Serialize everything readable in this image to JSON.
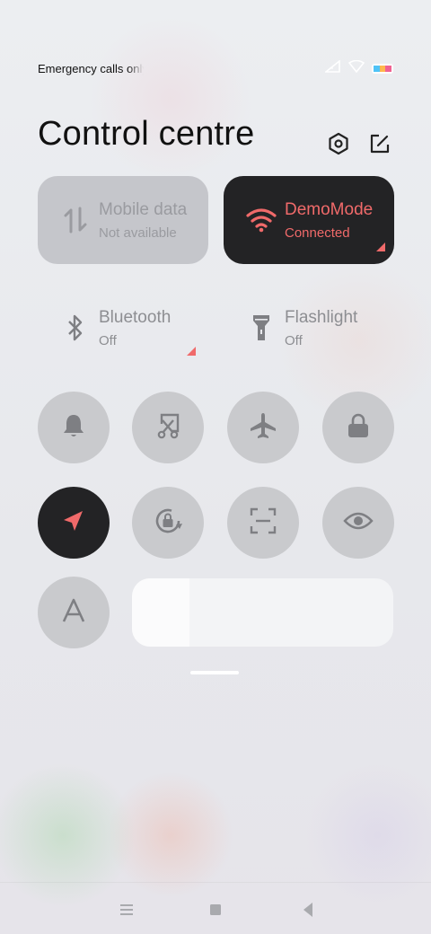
{
  "status_bar": {
    "carrier_text": "Emergency calls only",
    "icons": [
      "signal-icon",
      "wifi-icon",
      "battery-icon"
    ],
    "battery_colors": [
      "#4fc3f7",
      "#ffb74d",
      "#f06292"
    ]
  },
  "header": {
    "title": "Control centre",
    "icons": [
      "settings-icon",
      "edit-icon"
    ]
  },
  "tiles": {
    "mobile_data": {
      "label": "Mobile data",
      "status": "Not available",
      "active": false,
      "icon": "mobile-data-icon"
    },
    "wifi": {
      "label": "DemoMode",
      "status": "Connected",
      "active": true,
      "icon": "wifi-icon"
    },
    "bluetooth": {
      "label": "Bluetooth",
      "status": "Off",
      "icon": "bluetooth-icon"
    },
    "flashlight": {
      "label": "Flashlight",
      "status": "Off",
      "icon": "flashlight-icon"
    }
  },
  "toggles": [
    {
      "name": "silent",
      "icon": "bell-icon",
      "active": false
    },
    {
      "name": "screenshot",
      "icon": "screenshot-icon",
      "active": false
    },
    {
      "name": "airplane-mode",
      "icon": "airplane-icon",
      "active": false
    },
    {
      "name": "lock-screen",
      "icon": "lock-icon",
      "active": false
    },
    {
      "name": "location",
      "icon": "location-icon",
      "active": true
    },
    {
      "name": "rotation-lock",
      "icon": "rotation-lock-icon",
      "active": false
    },
    {
      "name": "scanner",
      "icon": "scan-icon",
      "active": false
    },
    {
      "name": "reading-mode",
      "icon": "eye-icon",
      "active": false
    },
    {
      "name": "auto-brightness",
      "icon": "auto-brightness-icon",
      "active": false
    }
  ],
  "brightness": {
    "level": 0.22
  },
  "colors": {
    "accent": "#f06a6a",
    "active_tile": "#232325",
    "inactive_round": "#c9cacd",
    "icon_gray": "#7e7f83"
  },
  "nav_bar": {
    "buttons": [
      "menu-icon",
      "home-icon",
      "back-icon"
    ]
  }
}
